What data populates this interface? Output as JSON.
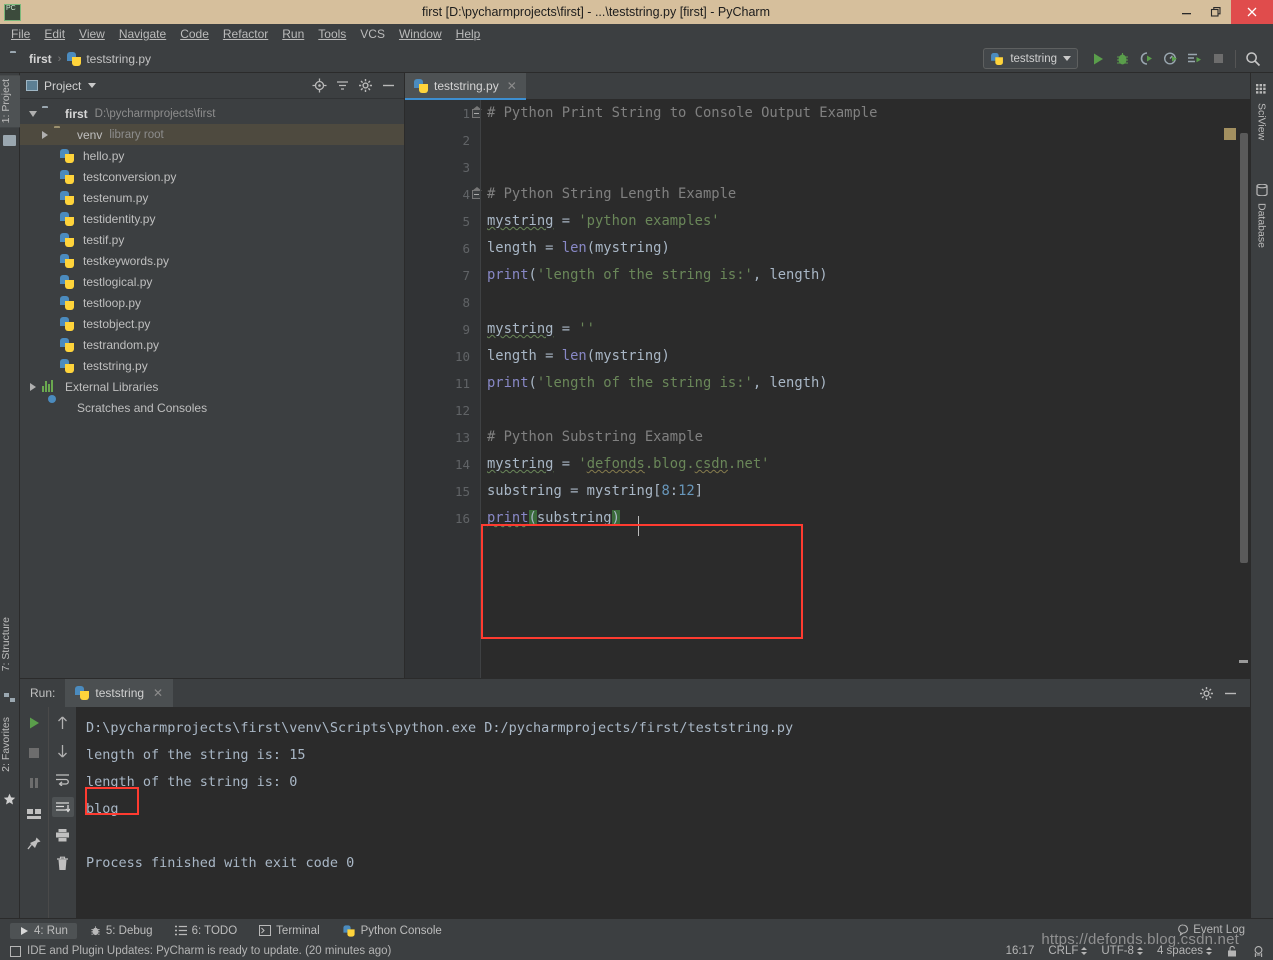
{
  "window": {
    "title": "first [D:\\pycharmprojects\\first] - ...\\teststring.py [first] - PyCharm",
    "logo_text": "PC",
    "minimize": "–",
    "maximize": "❐",
    "close": "✕"
  },
  "menu": [
    {
      "label": "File",
      "mnemonic": "F"
    },
    {
      "label": "Edit",
      "mnemonic": "E"
    },
    {
      "label": "View",
      "mnemonic": "V"
    },
    {
      "label": "Navigate",
      "mnemonic": "N"
    },
    {
      "label": "Code",
      "mnemonic": "C"
    },
    {
      "label": "Refactor",
      "mnemonic": "R"
    },
    {
      "label": "Run",
      "mnemonic": "u"
    },
    {
      "label": "Tools",
      "mnemonic": "T"
    },
    {
      "label": "VCS",
      "mnemonic": ""
    },
    {
      "label": "Window",
      "mnemonic": "W"
    },
    {
      "label": "Help",
      "mnemonic": "H"
    }
  ],
  "navbar": {
    "breadcrumb": [
      "first",
      "teststring.py"
    ],
    "separator": "›",
    "run_config": "teststring",
    "actions": [
      "run-icon",
      "debug-icon",
      "run-coverage-icon",
      "profile-icon",
      "run-with-console-icon",
      "stop-icon",
      "search-everywhere-icon"
    ]
  },
  "left_stripe": {
    "top": [
      {
        "label": "1: Project",
        "active": true
      }
    ],
    "bottom": [
      {
        "label": "7: Structure"
      },
      {
        "label": "2: Favorites"
      }
    ]
  },
  "right_stripe": [
    {
      "label": "SciView"
    },
    {
      "label": "Database"
    }
  ],
  "project": {
    "title": "Project",
    "actions": [
      "locate-icon",
      "collapse-all-icon",
      "settings-icon",
      "hide-icon"
    ],
    "tree": [
      {
        "label": "first",
        "detail": "D:\\pycharmprojects\\first",
        "indent": 0,
        "twisty": "down",
        "icon": "folder-icon",
        "bold": true,
        "selected": false
      },
      {
        "label": "venv",
        "detail": "library root",
        "indent": 1,
        "twisty": "right",
        "icon": "venv-folder-icon",
        "bold": false,
        "selected": true
      },
      {
        "label": "hello.py",
        "detail": "",
        "indent": 2,
        "twisty": "",
        "icon": "python-file-icon",
        "bold": false,
        "selected": false
      },
      {
        "label": "testconversion.py",
        "detail": "",
        "indent": 2,
        "twisty": "",
        "icon": "python-file-icon",
        "bold": false,
        "selected": false
      },
      {
        "label": "testenum.py",
        "detail": "",
        "indent": 2,
        "twisty": "",
        "icon": "python-file-icon",
        "bold": false,
        "selected": false
      },
      {
        "label": "testidentity.py",
        "detail": "",
        "indent": 2,
        "twisty": "",
        "icon": "python-file-icon",
        "bold": false,
        "selected": false
      },
      {
        "label": "testif.py",
        "detail": "",
        "indent": 2,
        "twisty": "",
        "icon": "python-file-icon",
        "bold": false,
        "selected": false
      },
      {
        "label": "testkeywords.py",
        "detail": "",
        "indent": 2,
        "twisty": "",
        "icon": "python-file-icon",
        "bold": false,
        "selected": false
      },
      {
        "label": "testlogical.py",
        "detail": "",
        "indent": 2,
        "twisty": "",
        "icon": "python-file-icon",
        "bold": false,
        "selected": false
      },
      {
        "label": "testloop.py",
        "detail": "",
        "indent": 2,
        "twisty": "",
        "icon": "python-file-icon",
        "bold": false,
        "selected": false
      },
      {
        "label": "testobject.py",
        "detail": "",
        "indent": 2,
        "twisty": "",
        "icon": "python-file-icon",
        "bold": false,
        "selected": false
      },
      {
        "label": "testrandom.py",
        "detail": "",
        "indent": 2,
        "twisty": "",
        "icon": "python-file-icon",
        "bold": false,
        "selected": false
      },
      {
        "label": "teststring.py",
        "detail": "",
        "indent": 2,
        "twisty": "",
        "icon": "python-file-icon",
        "bold": false,
        "selected": false
      },
      {
        "label": "External Libraries",
        "detail": "",
        "indent": 0,
        "twisty": "right",
        "icon": "library-icon",
        "bold": false,
        "selected": false
      },
      {
        "label": "Scratches and Consoles",
        "detail": "",
        "indent": 1,
        "twisty": "",
        "icon": "scratches-icon",
        "bold": false,
        "selected": false
      }
    ]
  },
  "editor": {
    "tabs": [
      {
        "label": "teststring.py",
        "icon": "python-file-icon",
        "close": "✕",
        "active": true
      }
    ],
    "line_numbers": [
      "1",
      "2",
      "3",
      "4",
      "5",
      "6",
      "7",
      "8",
      "9",
      "10",
      "11",
      "12",
      "13",
      "14",
      "15",
      "16"
    ],
    "lines": [
      {
        "n": 1,
        "segments": [
          {
            "t": "# Python Print String to Console Output Example",
            "c": "cmt"
          }
        ]
      },
      {
        "n": 2,
        "segments": []
      },
      {
        "n": 3,
        "segments": []
      },
      {
        "n": 4,
        "segments": [
          {
            "t": "# Python String Length Example",
            "c": "cmt"
          }
        ]
      },
      {
        "n": 5,
        "segments": [
          {
            "t": "mystring",
            "c": "var squig"
          },
          {
            "t": " = ",
            "c": "var"
          },
          {
            "t": "'python examples'",
            "c": "str"
          }
        ]
      },
      {
        "n": 6,
        "segments": [
          {
            "t": "length = ",
            "c": "var"
          },
          {
            "t": "len",
            "c": "bif"
          },
          {
            "t": "(mystring)",
            "c": "var"
          }
        ]
      },
      {
        "n": 7,
        "segments": [
          {
            "t": "print",
            "c": "bif"
          },
          {
            "t": "(",
            "c": "var"
          },
          {
            "t": "'length of the string is:'",
            "c": "str"
          },
          {
            "t": ", length)",
            "c": "var"
          }
        ]
      },
      {
        "n": 8,
        "segments": []
      },
      {
        "n": 9,
        "segments": [
          {
            "t": "mystring",
            "c": "var squig"
          },
          {
            "t": " = ",
            "c": "var"
          },
          {
            "t": "''",
            "c": "str"
          }
        ]
      },
      {
        "n": 10,
        "segments": [
          {
            "t": "length = ",
            "c": "var"
          },
          {
            "t": "len",
            "c": "bif"
          },
          {
            "t": "(mystring)",
            "c": "var"
          }
        ]
      },
      {
        "n": 11,
        "segments": [
          {
            "t": "print",
            "c": "bif"
          },
          {
            "t": "(",
            "c": "var"
          },
          {
            "t": "'length of the string is:'",
            "c": "str"
          },
          {
            "t": ", length)",
            "c": "var"
          }
        ]
      },
      {
        "n": 12,
        "segments": []
      },
      {
        "n": 13,
        "segments": [
          {
            "t": "# Python Substring Example",
            "c": "cmt"
          }
        ]
      },
      {
        "n": 14,
        "segments": [
          {
            "t": "mystring",
            "c": "var squig"
          },
          {
            "t": " = ",
            "c": "var"
          },
          {
            "t": "'",
            "c": "str"
          },
          {
            "t": "defonds",
            "c": "str squig"
          },
          {
            "t": ".blog.",
            "c": "str"
          },
          {
            "t": "csdn",
            "c": "str squig"
          },
          {
            "t": ".net'",
            "c": "str"
          }
        ]
      },
      {
        "n": 15,
        "segments": [
          {
            "t": "substring = mystring[",
            "c": "var"
          },
          {
            "t": "8",
            "c": "num"
          },
          {
            "t": ":",
            "c": "var"
          },
          {
            "t": "12",
            "c": "num"
          },
          {
            "t": "]",
            "c": "var"
          }
        ]
      },
      {
        "n": 16,
        "segments": [
          {
            "t": "print",
            "c": "bif squig"
          },
          {
            "t": "(",
            "c": "var parenhl"
          },
          {
            "t": "substring",
            "c": "var"
          },
          {
            "t": ")",
            "c": "var parenhl"
          }
        ]
      }
    ],
    "highlight_note": "red annotation box around lines 13-16"
  },
  "run_panel": {
    "label": "Run:",
    "tab": "teststring",
    "tab_close": "✕",
    "header_actions": [
      "settings-icon",
      "hide-icon"
    ],
    "tools_left": [
      "rerun-icon",
      "stop-icon",
      "pause-icon",
      "dump-threads-icon",
      "pin-tab-icon"
    ],
    "tools_right": [
      "up-arrow-icon",
      "down-arrow-icon",
      "soft-wrap-icon",
      "scroll-to-end-icon",
      "print-icon",
      "clear-all-icon"
    ],
    "console_lines": [
      "D:\\pycharmprojects\\first\\venv\\Scripts\\python.exe D:/pycharmprojects/first/teststring.py",
      "length of the string is: 15",
      "length of the string is: 0",
      "blog",
      "",
      "Process finished with exit code 0"
    ],
    "highlighted_output": "blog"
  },
  "bottom_toolbar": [
    {
      "label": "4: Run",
      "mnemonic": "4",
      "icon": "run-icon",
      "active": true
    },
    {
      "label": "5: Debug",
      "mnemonic": "5",
      "icon": "debug-icon",
      "active": false
    },
    {
      "label": "6: TODO",
      "mnemonic": "6",
      "icon": "todo-icon",
      "active": false
    },
    {
      "label": "Terminal",
      "mnemonic": "",
      "icon": "terminal-icon",
      "active": false
    },
    {
      "label": "Python Console",
      "mnemonic": "",
      "icon": "python-console-icon",
      "active": false
    }
  ],
  "statusbar": {
    "message": "IDE and Plugin Updates: PyCharm is ready to update. (20 minutes ago)",
    "message_icon": "notification-icon",
    "time": "16:17",
    "line_separator": "CRLF",
    "encoding": "UTF-8",
    "indent": "4 spaces",
    "event_log": "Event Log",
    "event_log_icon": "balloon-icon",
    "lock_icon": "unlocked-icon",
    "inspection_icon": "inspector-icon"
  },
  "watermark": "https://defonds.blog.csdn.net",
  "colors": {
    "titlebar": "#d6bf9c",
    "close_button": "#e04c4c",
    "chrome": "#3c3f41",
    "editor_bg": "#2b2b2b",
    "gutter": "#313335",
    "accent_tab": "#3d8fd1",
    "annotation": "#ff3b30",
    "comment": "#808080",
    "string": "#6a8759",
    "keyword": "#cc7832",
    "number": "#6897bb",
    "builtin": "#8888c6",
    "text": "#a9b7c6",
    "run_green": "#5a9e4b"
  }
}
